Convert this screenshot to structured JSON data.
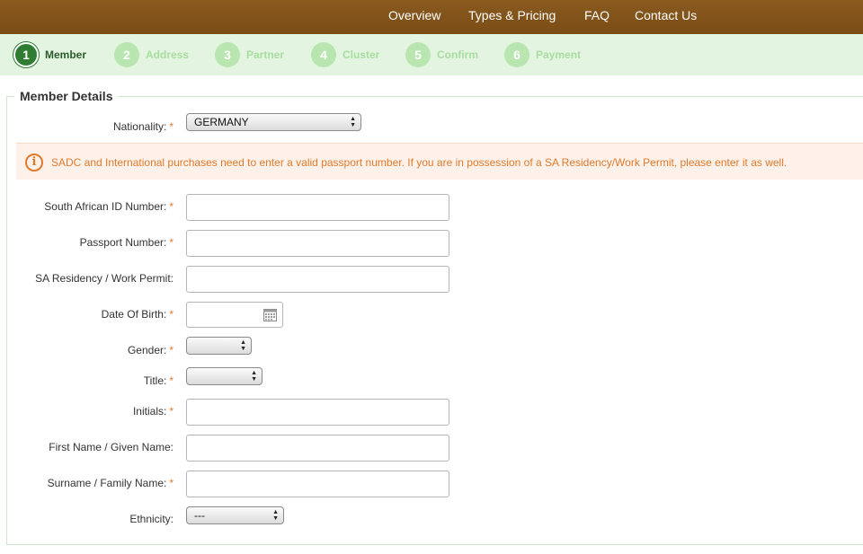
{
  "nav": {
    "items": [
      "Overview",
      "Types & Pricing",
      "FAQ",
      "Contact Us"
    ]
  },
  "steps": [
    {
      "number": "1",
      "label": "Member"
    },
    {
      "number": "2",
      "label": "Address"
    },
    {
      "number": "3",
      "label": "Partner"
    },
    {
      "number": "4",
      "label": "Cluster"
    },
    {
      "number": "5",
      "label": "Confirm"
    },
    {
      "number": "6",
      "label": "Payment"
    }
  ],
  "active_step": 1,
  "section": {
    "title": "Member Details"
  },
  "form": {
    "nationality": {
      "label": "Nationality:",
      "value": "GERMANY",
      "required": "*"
    },
    "notice": "SADC and International purchases need to enter a valid passport number. If you are in possession of a SA Residency/Work Permit, please enter it as well.",
    "sa_id": {
      "label": "South African ID Number:",
      "required": "*",
      "value": ""
    },
    "passport": {
      "label": "Passport Number:",
      "required": "*",
      "value": ""
    },
    "permit": {
      "label": "SA Residency / Work Permit:",
      "value": ""
    },
    "dob": {
      "label": "Date Of Birth:",
      "required": "*",
      "value": ""
    },
    "gender": {
      "label": "Gender:",
      "required": "*",
      "value": ""
    },
    "title": {
      "label": "Title:",
      "required": "*",
      "value": ""
    },
    "initials": {
      "label": "Initials:",
      "required": "*",
      "value": ""
    },
    "first_name": {
      "label": "First Name / Given Name:",
      "value": ""
    },
    "surname": {
      "label": "Surname / Family Name:",
      "required": "*",
      "value": ""
    },
    "ethnicity": {
      "label": "Ethnicity:",
      "value": "---"
    }
  },
  "colors": {
    "nav_bg": "#7a4d15",
    "steps_bg": "#e3f5e1",
    "active_step": "#2e7d32",
    "inactive_step": "#b9e5b0",
    "required": "#e07a2b",
    "notice_bg": "#fdf1ea",
    "notice_text": "#e07a2b"
  },
  "icons": {
    "notice": "info-icon",
    "dob": "calendar-icon",
    "select": "up-down-arrows-icon"
  }
}
